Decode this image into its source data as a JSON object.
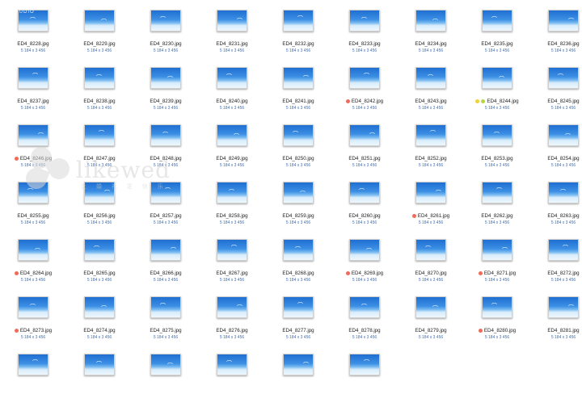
{
  "watermark": {
    "text": "likewed",
    "subtitle": "让 婚 礼 更 快 乐"
  },
  "corner_tag": "STUDIO",
  "file_dimensions": "5 184 x 3 456",
  "colors": {
    "label_red": "#ef6b5a",
    "label_green": "#b6d83a",
    "label_yellow": "#f2d23a",
    "dimension_text": "#3d6fb6"
  },
  "files": [
    {
      "name": "ED4_8228.jpg",
      "tags": []
    },
    {
      "name": "ED4_8229.jpg",
      "tags": []
    },
    {
      "name": "ED4_8230.jpg",
      "tags": []
    },
    {
      "name": "ED4_8231.jpg",
      "tags": []
    },
    {
      "name": "ED4_8232.jpg",
      "tags": []
    },
    {
      "name": "ED4_8233.jpg",
      "tags": []
    },
    {
      "name": "ED4_8234.jpg",
      "tags": []
    },
    {
      "name": "ED4_8235.jpg",
      "tags": []
    },
    {
      "name": "ED4_8236.jpg",
      "tags": []
    },
    {
      "name": "ED4_8237.jpg",
      "tags": []
    },
    {
      "name": "ED4_8238.jpg",
      "tags": []
    },
    {
      "name": "ED4_8239.jpg",
      "tags": []
    },
    {
      "name": "ED4_8240.jpg",
      "tags": []
    },
    {
      "name": "ED4_8241.jpg",
      "tags": []
    },
    {
      "name": "ED4_8242.jpg",
      "tags": [
        "red"
      ]
    },
    {
      "name": "ED4_8243.jpg",
      "tags": []
    },
    {
      "name": "ED4_8244.jpg",
      "tags": [
        "yellow",
        "green"
      ]
    },
    {
      "name": "ED4_8245.jpg",
      "tags": []
    },
    {
      "name": "ED4_8246.jpg",
      "tags": [
        "red"
      ]
    },
    {
      "name": "ED4_8247.jpg",
      "tags": []
    },
    {
      "name": "ED4_8248.jpg",
      "tags": []
    },
    {
      "name": "ED4_8249.jpg",
      "tags": []
    },
    {
      "name": "ED4_8250.jpg",
      "tags": []
    },
    {
      "name": "ED4_8251.jpg",
      "tags": []
    },
    {
      "name": "ED4_8252.jpg",
      "tags": []
    },
    {
      "name": "ED4_8253.jpg",
      "tags": []
    },
    {
      "name": "ED4_8254.jpg",
      "tags": []
    },
    {
      "name": "ED4_8255.jpg",
      "tags": []
    },
    {
      "name": "ED4_8256.jpg",
      "tags": []
    },
    {
      "name": "ED4_8257.jpg",
      "tags": []
    },
    {
      "name": "ED4_8258.jpg",
      "tags": []
    },
    {
      "name": "ED4_8259.jpg",
      "tags": []
    },
    {
      "name": "ED4_8260.jpg",
      "tags": []
    },
    {
      "name": "ED4_8261.jpg",
      "tags": [
        "red"
      ]
    },
    {
      "name": "ED4_8262.jpg",
      "tags": []
    },
    {
      "name": "ED4_8263.jpg",
      "tags": []
    },
    {
      "name": "ED4_8264.jpg",
      "tags": [
        "red"
      ]
    },
    {
      "name": "ED4_8265.jpg",
      "tags": []
    },
    {
      "name": "ED4_8266.jpg",
      "tags": []
    },
    {
      "name": "ED4_8267.jpg",
      "tags": []
    },
    {
      "name": "ED4_8268.jpg",
      "tags": []
    },
    {
      "name": "ED4_8269.jpg",
      "tags": [
        "red"
      ]
    },
    {
      "name": "ED4_8270.jpg",
      "tags": []
    },
    {
      "name": "ED4_8271.jpg",
      "tags": [
        "red"
      ]
    },
    {
      "name": "ED4_8272.jpg",
      "tags": []
    },
    {
      "name": "ED4_8273.jpg",
      "tags": [
        "red"
      ]
    },
    {
      "name": "ED4_8274.jpg",
      "tags": []
    },
    {
      "name": "ED4_8275.jpg",
      "tags": []
    },
    {
      "name": "ED4_8276.jpg",
      "tags": []
    },
    {
      "name": "ED4_8277.jpg",
      "tags": []
    },
    {
      "name": "ED4_8278.jpg",
      "tags": []
    },
    {
      "name": "ED4_8279.jpg",
      "tags": []
    },
    {
      "name": "ED4_8280.jpg",
      "tags": [
        "red"
      ]
    },
    {
      "name": "ED4_8281.jpg",
      "tags": []
    },
    {
      "name": "",
      "tags": []
    },
    {
      "name": "",
      "tags": []
    },
    {
      "name": "",
      "tags": []
    },
    {
      "name": "",
      "tags": []
    },
    {
      "name": "",
      "tags": []
    },
    {
      "name": "",
      "tags": []
    }
  ]
}
